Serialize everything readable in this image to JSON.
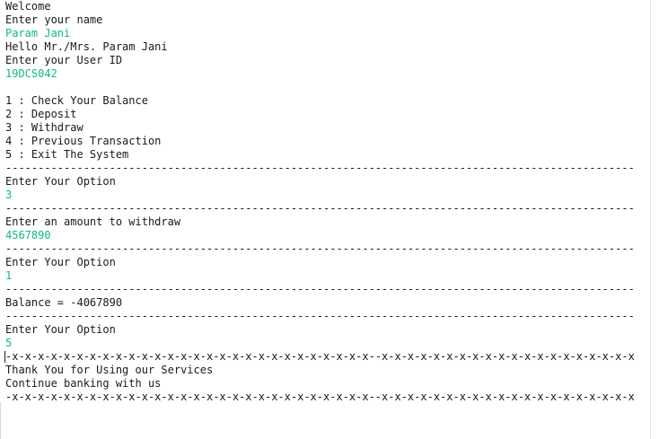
{
  "console": {
    "lines": [
      {
        "text": "Welcome",
        "kind": "output"
      },
      {
        "text": "Enter your name",
        "kind": "output"
      },
      {
        "text": "Param Jani",
        "kind": "input"
      },
      {
        "text": "Hello Mr./Mrs. Param Jani",
        "kind": "output"
      },
      {
        "text": "Enter your User ID",
        "kind": "output"
      },
      {
        "text": "19DCS042",
        "kind": "input"
      },
      {
        "text": "",
        "kind": "blank"
      },
      {
        "text": "1 : Check Your Balance",
        "kind": "output"
      },
      {
        "text": "2 : Deposit",
        "kind": "output"
      },
      {
        "text": "3 : Withdraw",
        "kind": "output"
      },
      {
        "text": "4 : Previous Transaction",
        "kind": "output"
      },
      {
        "text": "5 : Exit The System",
        "kind": "output"
      },
      {
        "text": "----------------------------------------------------------------------------------------------------",
        "kind": "output"
      },
      {
        "text": "Enter Your Option",
        "kind": "output"
      },
      {
        "text": "3",
        "kind": "input"
      },
      {
        "text": "----------------------------------------------------------------------------------------------------",
        "kind": "output"
      },
      {
        "text": "Enter an amount to withdraw",
        "kind": "output"
      },
      {
        "text": "4567890",
        "kind": "input"
      },
      {
        "text": "----------------------------------------------------------------------------------------------------",
        "kind": "output"
      },
      {
        "text": "Enter Your Option",
        "kind": "output"
      },
      {
        "text": "1",
        "kind": "input"
      },
      {
        "text": "----------------------------------------------------------------------------------------------------",
        "kind": "output"
      },
      {
        "text": "Balance = -4067890",
        "kind": "output"
      },
      {
        "text": "----------------------------------------------------------------------------------------------------",
        "kind": "output"
      },
      {
        "text": "Enter Your Option",
        "kind": "output"
      },
      {
        "text": "5",
        "kind": "input"
      },
      {
        "text": "-x-x-x-x-x-x-x-x-x-x-x-x-x-x-x-x-x-x-x-x-x-x-x-x-x-x-x-x--x-x-x-x-x-x-x-x-x-x-x-x-x-x-x-x-x-x-x-x-x-x-",
        "kind": "output"
      },
      {
        "text": "Thank You for Using our Services",
        "kind": "output"
      },
      {
        "text": "Continue banking with us",
        "kind": "output"
      },
      {
        "text": "-x-x-x-x-x-x-x-x-x-x-x-x-x-x-x-x-x-x-x-x-x-x-x-x-x-x-x-x--x-x-x-x-x-x-x-x-x-x-x-x-x-x-x-x-x-x-x-x-x-x-",
        "kind": "output"
      }
    ]
  },
  "colors": {
    "background": "#ffffff",
    "output_text": "#1a1a1a",
    "input_text": "#12b886"
  }
}
